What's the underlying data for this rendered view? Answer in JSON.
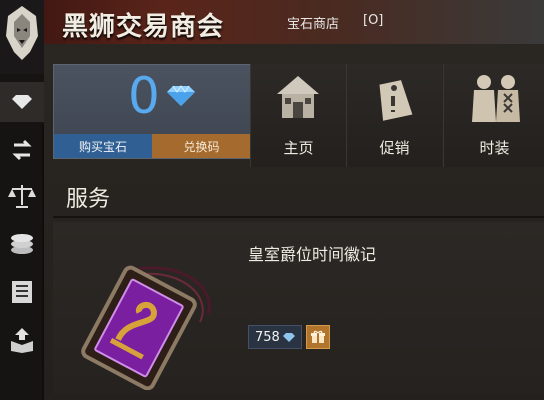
{
  "header": {
    "title": "黑狮交易商会",
    "store_label": "宝石商店",
    "shortcut": "[O]"
  },
  "sidebar": {
    "items": [
      {
        "icon": "gem-icon",
        "active": true
      },
      {
        "icon": "exchange-icon"
      },
      {
        "icon": "scale-icon"
      },
      {
        "icon": "coins-icon"
      },
      {
        "icon": "list-icon"
      },
      {
        "icon": "box-upload-icon"
      }
    ]
  },
  "wallet": {
    "gems": "0",
    "buy_label": "购买宝石",
    "code_label": "兑换码"
  },
  "nav": [
    {
      "label": "主页",
      "icon": "house-icon"
    },
    {
      "label": "促销",
      "icon": "price-tag-icon"
    },
    {
      "label": "时装",
      "icon": "outfit-icon"
    }
  ],
  "section": {
    "title": "服务"
  },
  "item": {
    "name": "皇室爵位时间徽记",
    "price": "758",
    "price_icon": "gem-icon",
    "gift_icon": "gift-icon"
  },
  "colors": {
    "gem_blue": "#59a9ef",
    "buy_button": "#2f5f93",
    "code_button": "#a46a2e",
    "gift_button": "#b0742c"
  }
}
